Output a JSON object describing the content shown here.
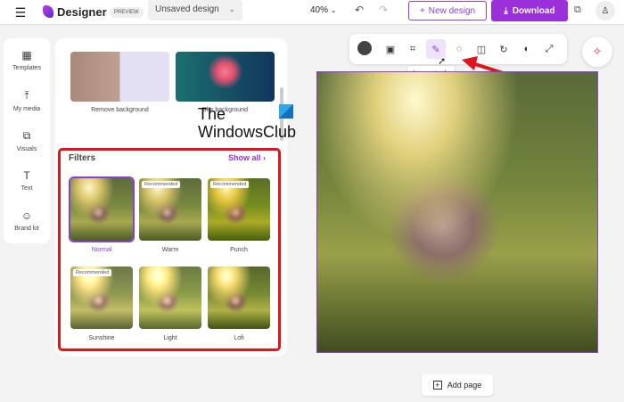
{
  "header": {
    "app_name": "Designer",
    "badge": "PREVIEW",
    "design_name": "Unsaved design",
    "zoom": "40%",
    "new_design": "New design",
    "download": "Download"
  },
  "rail": [
    {
      "label": "Templates",
      "icon": "▦"
    },
    {
      "label": "My media",
      "icon": "⤒"
    },
    {
      "label": "Visuals",
      "icon": "⧉"
    },
    {
      "label": "Text",
      "icon": "T"
    },
    {
      "label": "Brand kit",
      "icon": "☺"
    }
  ],
  "panel": {
    "bg_tools": [
      "Remove background",
      "Blur background"
    ],
    "filters_title": "Filters",
    "show_all": "Show all",
    "filters": [
      {
        "name": "Normal",
        "badge": ""
      },
      {
        "name": "Warm",
        "badge": "Recommended"
      },
      {
        "name": "Punch",
        "badge": "Recommended"
      },
      {
        "name": "Sunshine",
        "badge": "Recommended"
      },
      {
        "name": "Light",
        "badge": ""
      },
      {
        "name": "Lofi",
        "badge": ""
      }
    ]
  },
  "watermark": {
    "line1": "The",
    "line2": "WindowsClub"
  },
  "toolbar": {
    "tooltip": "Image tools"
  },
  "add_page": "Add page",
  "colors": {
    "accent": "#8b3fd9",
    "highlight": "#e0141b"
  }
}
